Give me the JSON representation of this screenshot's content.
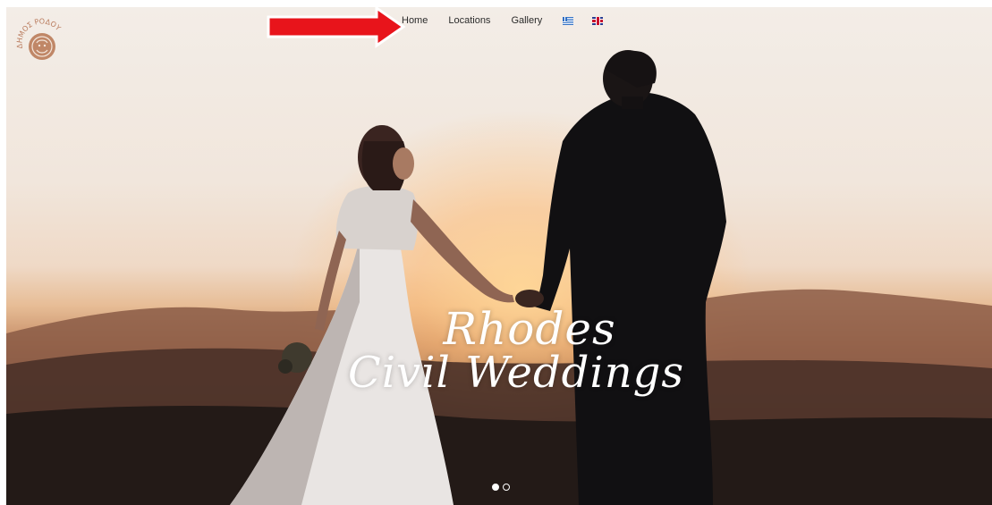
{
  "logo": {
    "text": "ΔΗΜΟΣ ΡΟΔΟΥ"
  },
  "nav": {
    "items": [
      {
        "label": "Home"
      },
      {
        "label": "Locations"
      },
      {
        "label": "Gallery"
      }
    ],
    "languages": [
      {
        "icon": "greek-flag-icon"
      },
      {
        "icon": "uk-flag-icon"
      }
    ]
  },
  "hero": {
    "title_line1": "Rhodes",
    "title_line2": "Civil Weddings"
  },
  "carousel": {
    "slide_count": 2,
    "active_slide": 1
  },
  "colors": {
    "arrow": "#e8141b",
    "nav_text": "#2b2b2b",
    "logo": "#b97a5c"
  }
}
